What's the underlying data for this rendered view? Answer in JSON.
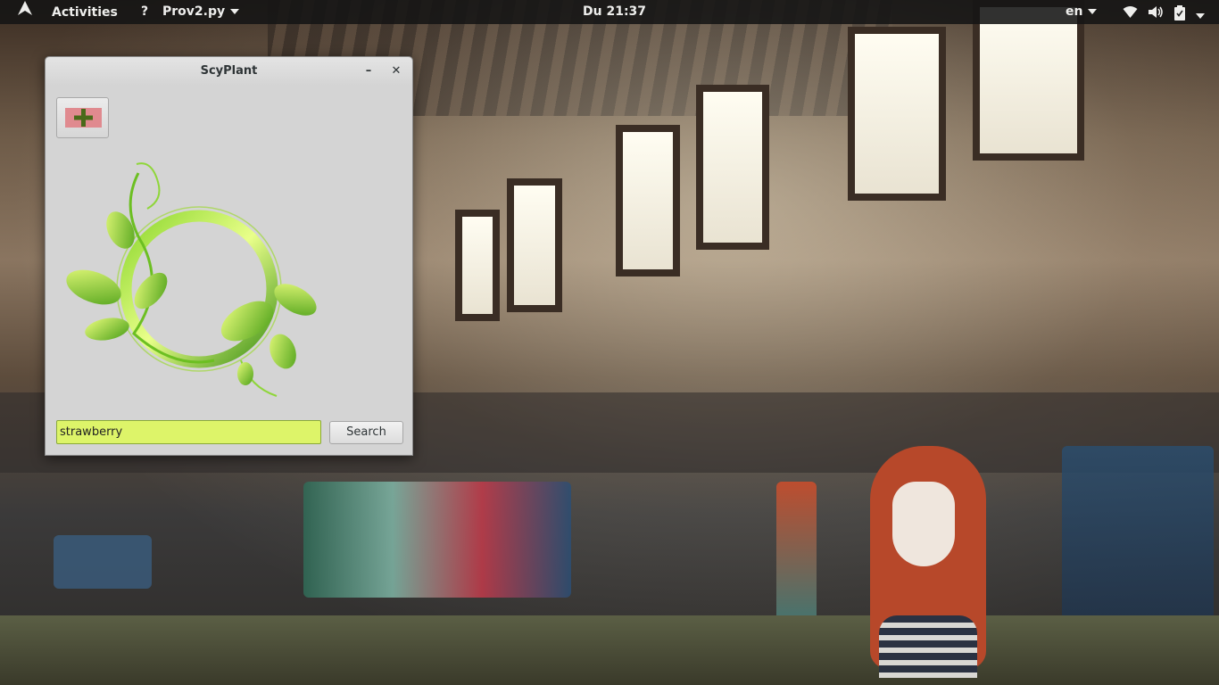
{
  "topbar": {
    "activities_label": "Activities",
    "app_menu_label": "Prov2.py",
    "clock": "Du 21:37",
    "keyboard_layout": "en"
  },
  "window": {
    "title": "ScyPlant",
    "minimize_label": "–",
    "close_label": "✕"
  },
  "search": {
    "value": "strawberry",
    "button_label": "Search"
  },
  "icons": {
    "activities": "gnome-foot-icon",
    "app_menu": "help-question-icon",
    "wifi": "wifi-icon",
    "volume": "volume-icon",
    "battery": "battery-icon",
    "power": "power-menu-icon",
    "add": "add-plus-icon",
    "plant": "plant-vine-icon"
  },
  "colors": {
    "input_bg": "#ddf469",
    "add_button_fill": "#e08a8f",
    "plus_color": "#4a6a1a",
    "leaf_green": "#7cc62a"
  }
}
